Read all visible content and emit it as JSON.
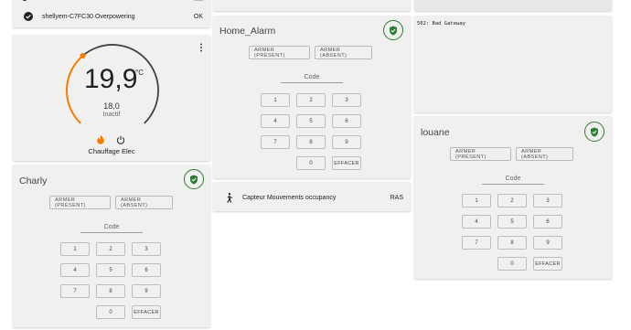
{
  "sensor": {
    "name": "shellyem-C7FC30 Overpowering",
    "state": "OK"
  },
  "thermostat": {
    "temperature": "19,9",
    "unit": "°C",
    "target": "18,0",
    "status": "Inactif",
    "name": "Chauffage Elec",
    "menu_icon": "more-vert-icon",
    "progress_fraction": 0.35
  },
  "home_alarm": {
    "title": "Home_Alarm"
  },
  "charly": {
    "title": "Charly"
  },
  "louane": {
    "title": "louane"
  },
  "alarm_buttons": {
    "arm_home": "ARMER (PRÉSENT)",
    "arm_away": "ARMER (ABSENT)"
  },
  "keypad": {
    "code_label": "Code",
    "keys": [
      "1",
      "2",
      "3",
      "4",
      "5",
      "6",
      "7",
      "8",
      "9",
      "0"
    ],
    "clear": "EFFACER"
  },
  "gateway": {
    "error": "502: Bad Gateway"
  },
  "motion": {
    "name": "Capteur Mouvements occupancy",
    "state": "RAS"
  },
  "colors": {
    "accent": "#f57c00",
    "shield": "#2e7d32",
    "card": "#f0f0f0"
  }
}
